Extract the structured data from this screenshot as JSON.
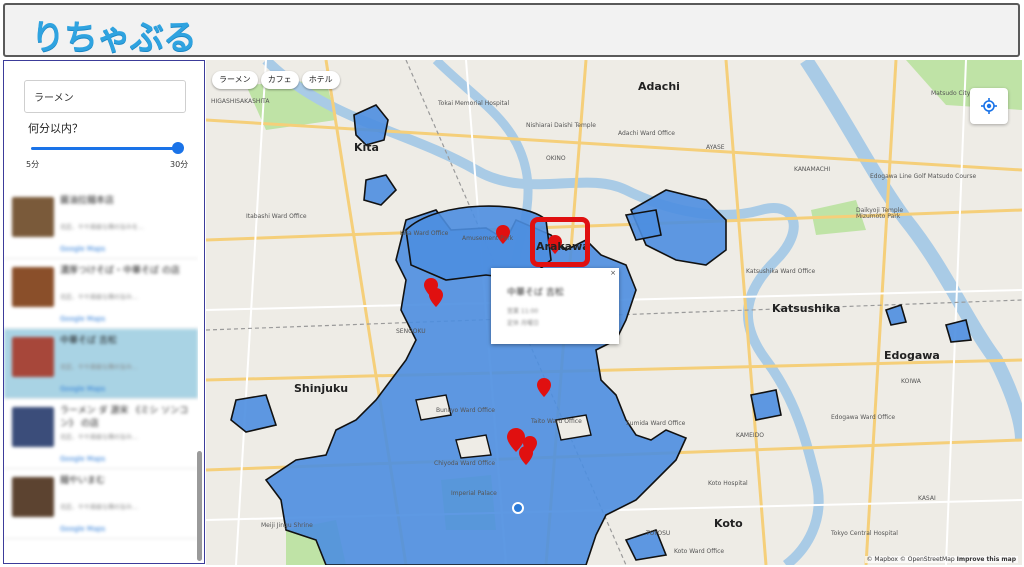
{
  "app": {
    "logo_text": "りちゃぶる",
    "logo_color": "#2fa3e0"
  },
  "sidebar": {
    "search": {
      "value": "ラーメン"
    },
    "minutes_label": "何分以内？",
    "slider": {
      "min_label": "5分",
      "max_label": "30分",
      "value_fraction": 1.0,
      "accent": "#1a73e8"
    },
    "results": [
      {
        "name": "醤油拉麺本店",
        "meta": "北区、やや高級な鶏の旨みを...",
        "link": "Google Maps",
        "selected": false,
        "thumb_color": "#7a5a3a"
      },
      {
        "name": "濃厚つけそば・中華そば の店",
        "meta": "北区、やや高級な鶏の旨み...",
        "link": "Google Maps",
        "selected": false,
        "thumb_color": "#8a4f2a"
      },
      {
        "name": "中華そば 吉松",
        "meta": "北区、やや高級な鶏の旨み...",
        "link": "Google Maps",
        "selected": true,
        "thumb_color": "#a7473a"
      },
      {
        "name": "ラーメン ダ 源宋 《ミシ ソンコン》 の店",
        "meta": "北区、やや高級な鶏の旨み...",
        "link": "Google Maps",
        "selected": false,
        "thumb_color": "#3b4d7a"
      },
      {
        "name": "麺やいまむ",
        "meta": "北区、やや高級な鶏の旨み...",
        "link": "Google Maps",
        "selected": false,
        "thumb_color": "#5c4330"
      }
    ]
  },
  "map": {
    "filter_chips": [
      "ラーメン",
      "カフェ",
      "ホテル"
    ],
    "ward_labels": {
      "adachi": "Adachi",
      "kita": "Kita",
      "arakawa": "Arakawa",
      "katsushika": "Katsushika",
      "shinjuku": "Shinjuku",
      "edogawa": "Edogawa",
      "koto": "Koto"
    },
    "place_labels": {
      "itabashi": "Itabashi Ward Office",
      "kita_ward": "Kita Ward Office",
      "adachi_ward": "Adachi Ward Office",
      "katsushika_ward": "Katsushika Ward Office",
      "edogawa_ward": "Edogawa Ward Office",
      "bunkyo_ward": "Bunkyo Ward Office",
      "taito_ward": "Taito Ward Office",
      "chiyoda_ward": "Chiyoda Ward Office",
      "koto_ward": "Koto Ward Office",
      "sumida_ward": "Sumida Ward Office",
      "imperial_palace": "Imperial Palace",
      "meiji": "Meiji Jingu Shrine",
      "amusement": "Amusement Park",
      "kanamachi": "KANAMACHI",
      "ayase": "AYASE",
      "okino": "OKINO",
      "kameido": "KAMEIDO",
      "sengoku": "SENGOKU",
      "kohoku": "HIGASHISAKASHITA",
      "mizumoto": "Mizumoto Park",
      "koiwa": "KOIWA",
      "kasai": "KASAI",
      "toyosu": "TOYOSU",
      "edogawa_golf": "Edogawa Line Golf Matsudo Course",
      "daikyoji": "Daikyoji Temple",
      "nishiarai": "Nishiarai Daishi Temple",
      "tokai_hosp": "Tokai Memorial Hospital",
      "koto_hosp": "Koto Hospital",
      "tokyo_hosp": "Tokyo Central Hospital",
      "matsudo": "Matsudo City"
    },
    "popup": {
      "close": "×",
      "title": "中華そば 吉松",
      "line1": "営業 11:00",
      "line2": "定休 月曜日"
    },
    "attribution": {
      "mapbox": "© Mapbox",
      "osm": "© OpenStreetMap",
      "improve": "Improve this map"
    },
    "colors": {
      "isochrone": "#4d8ee0",
      "land": "#eeece6",
      "water": "#a9cbe6",
      "park": "#bfe3a6",
      "pin": "#e01010"
    }
  }
}
